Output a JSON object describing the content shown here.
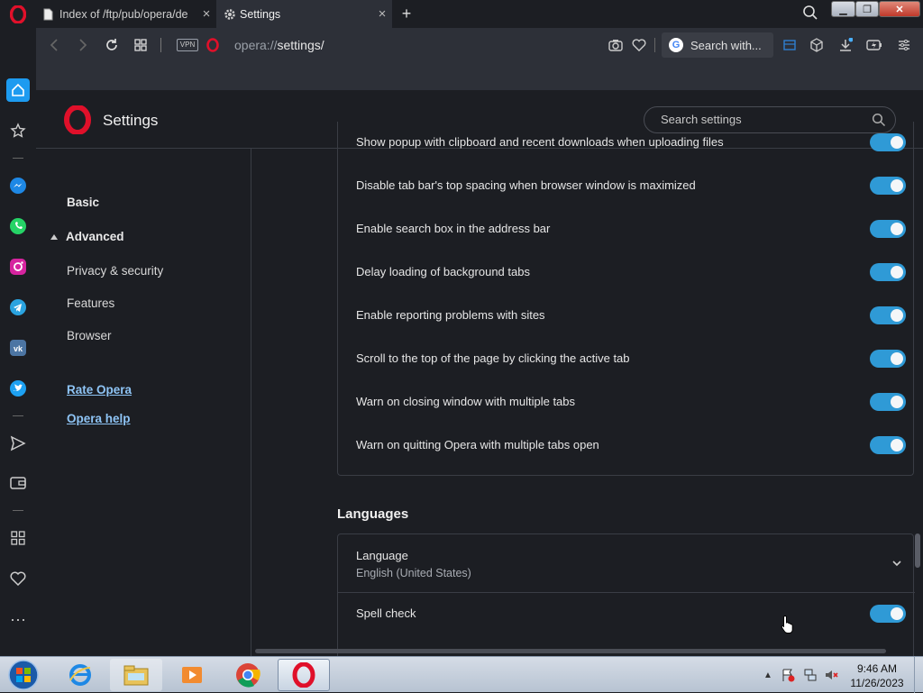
{
  "browser": {
    "tabs": [
      {
        "title": "Index of /ftp/pub/opera/de",
        "active": false
      },
      {
        "title": "Settings",
        "active": true
      }
    ],
    "address": {
      "scheme": "opera://",
      "path": "settings/"
    },
    "vpn_label": "VPN",
    "search_engine_label": "Search with...",
    "search_engine_letter": "G"
  },
  "settings": {
    "title": "Settings",
    "search_placeholder": "Search settings",
    "nav": {
      "basic": "Basic",
      "advanced": "Advanced",
      "privacy": "Privacy & security",
      "features": "Features",
      "browser": "Browser",
      "rate": "Rate Opera",
      "help": "Opera help"
    },
    "advanced_rows": [
      {
        "label": "Show popup with clipboard and recent downloads when uploading files",
        "enabled": true
      },
      {
        "label": "Disable tab bar's top spacing when browser window is maximized",
        "enabled": true
      },
      {
        "label": "Enable search box in the address bar",
        "enabled": true
      },
      {
        "label": "Delay loading of background tabs",
        "enabled": true
      },
      {
        "label": "Enable reporting problems with sites",
        "enabled": true
      },
      {
        "label": "Scroll to the top of the page by clicking the active tab",
        "enabled": true
      },
      {
        "label": "Warn on closing window with multiple tabs",
        "enabled": true
      },
      {
        "label": "Warn on quitting Opera with multiple tabs open",
        "enabled": true
      }
    ],
    "languages": {
      "heading": "Languages",
      "language_label": "Language",
      "language_value": "English (United States)",
      "spell_check_label": "Spell check",
      "spell_check_enabled": true
    }
  },
  "taskbar": {
    "time": "9:46 AM",
    "date": "11/26/2023"
  },
  "colors": {
    "accent": "#2f9ad6",
    "opera_red": "#e0102a",
    "link": "#8ec4f5"
  }
}
